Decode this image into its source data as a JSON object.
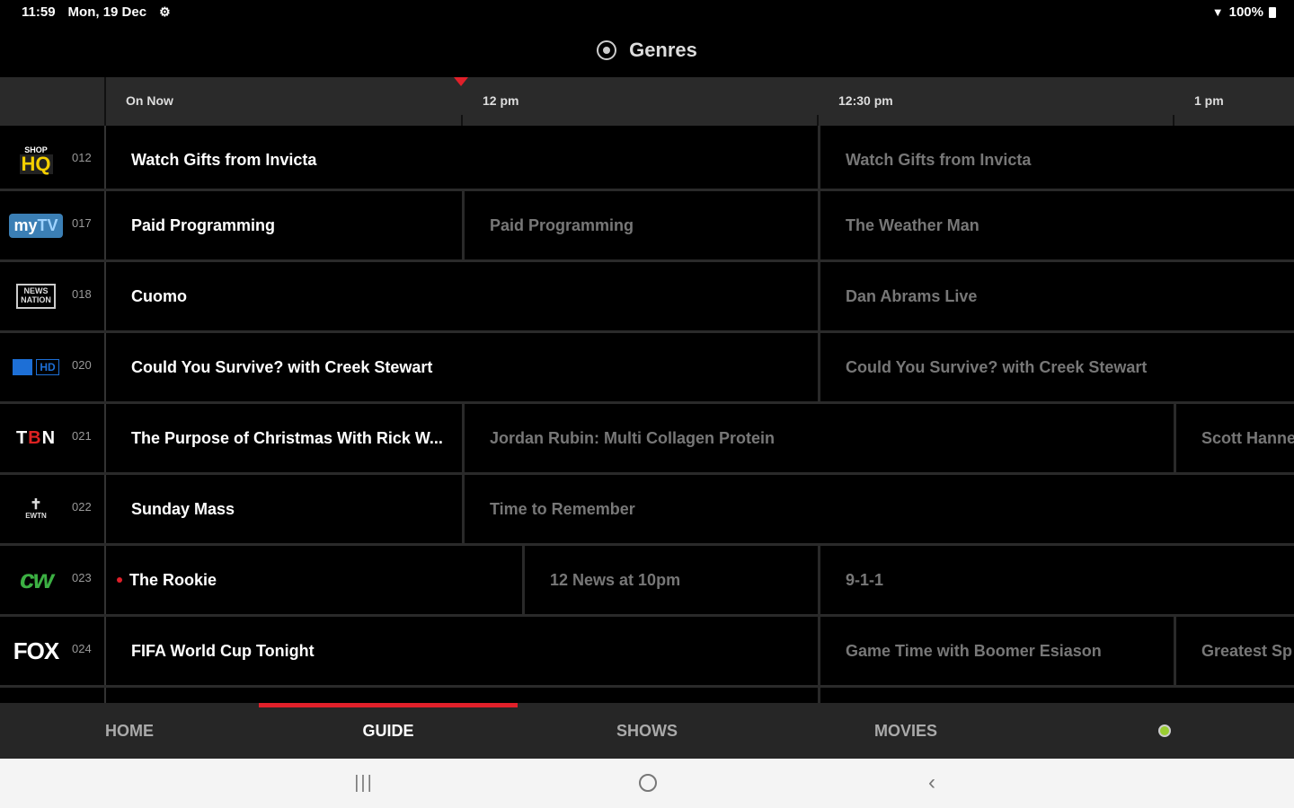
{
  "status": {
    "time": "11:59",
    "date": "Mon, 19 Dec",
    "battery": "100%"
  },
  "header": {
    "title": "Genres"
  },
  "timeline": {
    "slots": [
      "On Now",
      "12 pm",
      "12:30 pm",
      "1 pm"
    ]
  },
  "channels": [
    {
      "logo": "SHOP HQ",
      "number": "012",
      "programs": [
        "Watch Gifts from Invicta",
        "Watch Gifts from Invicta"
      ]
    },
    {
      "logo": "myTV",
      "number": "017",
      "programs": [
        "Paid Programming",
        "Paid Programming",
        "The Weather Man"
      ]
    },
    {
      "logo": "NEWS NATION",
      "number": "018",
      "programs": [
        "Cuomo",
        "Dan Abrams Live"
      ]
    },
    {
      "logo": "HD",
      "number": "020",
      "programs": [
        "Could You Survive? with Creek Stewart",
        "Could You Survive? with Creek Stewart"
      ]
    },
    {
      "logo": "TBN",
      "number": "021",
      "programs": [
        "The Purpose of Christmas With Rick W...",
        "Jordan Rubin: Multi Collagen Protein",
        "Scott Hanne"
      ]
    },
    {
      "logo": "EWTN",
      "number": "022",
      "programs": [
        "Sunday Mass",
        "Time to Remember"
      ]
    },
    {
      "logo": "CW",
      "number": "023",
      "programs": [
        "The Rookie",
        "12 News at 10pm",
        "9-1-1"
      ]
    },
    {
      "logo": "FOX",
      "number": "024",
      "programs": [
        "FIFA World Cup Tonight",
        "Game Time with Boomer Esiason",
        "Greatest Sp"
      ]
    }
  ],
  "tabs": [
    "HOME",
    "GUIDE",
    "SHOWS",
    "MOVIES"
  ],
  "colors": {
    "accent": "#e0202a",
    "cw_green": "#3cb043",
    "shop_yellow": "#f5d000"
  }
}
